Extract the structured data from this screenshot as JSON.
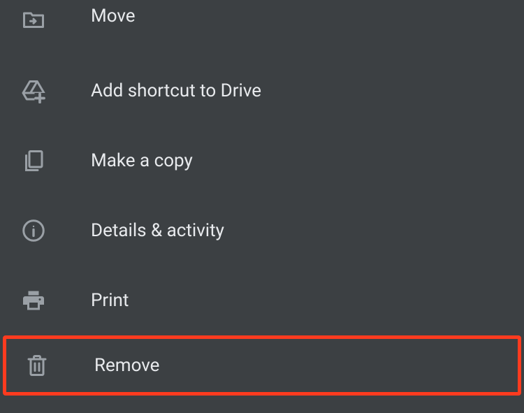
{
  "menu": {
    "items": [
      {
        "label": "Move"
      },
      {
        "label": "Add shortcut to Drive"
      },
      {
        "label": "Make a copy"
      },
      {
        "label": "Details & activity"
      },
      {
        "label": "Print"
      },
      {
        "label": "Remove"
      }
    ]
  }
}
